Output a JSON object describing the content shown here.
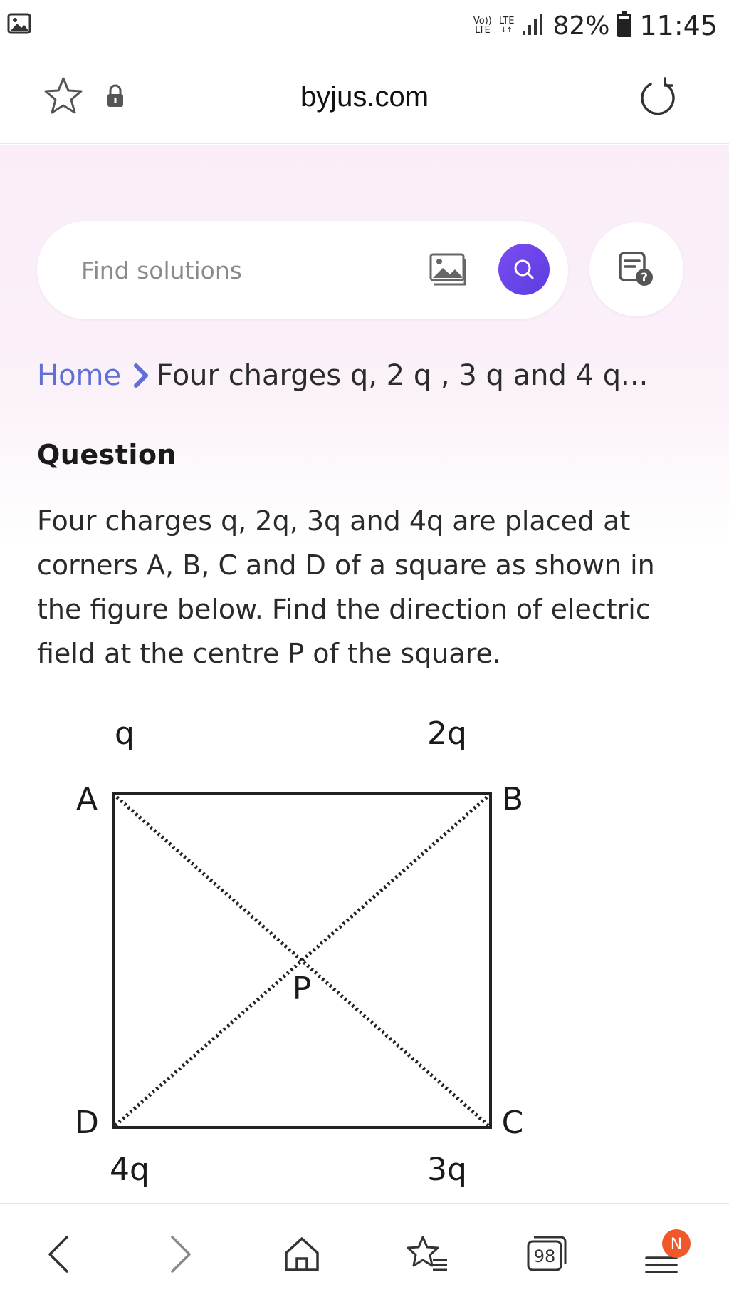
{
  "status_bar": {
    "net_top": "Vo))",
    "net_bottom": "LTE",
    "lte_label": "LTE",
    "battery": "82%",
    "time": "11:45"
  },
  "address_bar": {
    "url": "byjus.com"
  },
  "search": {
    "placeholder": "Find solutions"
  },
  "breadcrumb": {
    "home": "Home",
    "current": "Four charges q, 2 q , 3 q and 4 q..."
  },
  "question": {
    "heading": "Question",
    "text": "Four charges q, 2q, 3q and 4q are placed at corners A, B, C and D of a square as shown in the figure below. Find the direction of electric field at the centre P of the square."
  },
  "figure": {
    "charge_a": "q",
    "charge_b": "2q",
    "charge_c": "3q",
    "charge_d": "4q",
    "corner_a": "A",
    "corner_b": "B",
    "corner_c": "C",
    "corner_d": "D",
    "centre": "P"
  },
  "bottom_nav": {
    "tabs_count": "98",
    "badge": "N",
    "badge_color": "#f0582a"
  },
  "colors": {
    "accent": "#6a45e8",
    "link": "#5f6fd8"
  }
}
